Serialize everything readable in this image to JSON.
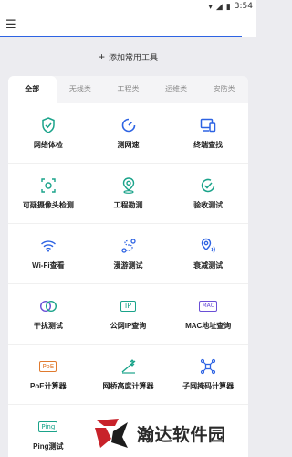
{
  "status_bar": {
    "time": "3:54"
  },
  "top_bar": {
    "menu_icon": "hamburger-icon"
  },
  "add_bar": {
    "label": "添加常用工具"
  },
  "tabs": [
    {
      "label": "全部",
      "active": true
    },
    {
      "label": "无线类",
      "active": false
    },
    {
      "label": "工程类",
      "active": false
    },
    {
      "label": "运维类",
      "active": false
    },
    {
      "label": "安防类",
      "active": false
    }
  ],
  "tools": {
    "network_check": "网络体检",
    "speed_test": "测网速",
    "terminal_search": "终端查找",
    "suspicious_camera": "可疑摄像头检测",
    "site_survey": "工程勘测",
    "acceptance_test": "验收测试",
    "wifi_view": "Wi-Fi查看",
    "roaming_test": "漫游测试",
    "attenuation_test": "衰减测试",
    "interference_test": "干扰测试",
    "public_ip": "公网IP查询",
    "mac_query": "MAC地址查询",
    "poe_calc": "PoE计算器",
    "bridge_height_calc": "网桥高度计算器",
    "subnet_calc": "子网掩码计算器",
    "ping_test": "Ping测试"
  },
  "badges": {
    "ip": "IP",
    "mac": "MAC",
    "poe": "PoE",
    "ping": "Ping"
  },
  "watermark": {
    "text": "瀚达软件园"
  },
  "colors": {
    "accent": "#2d63e3",
    "teal": "#1aa38a",
    "purple": "#6a4fd6",
    "orange": "#e07a2e"
  }
}
